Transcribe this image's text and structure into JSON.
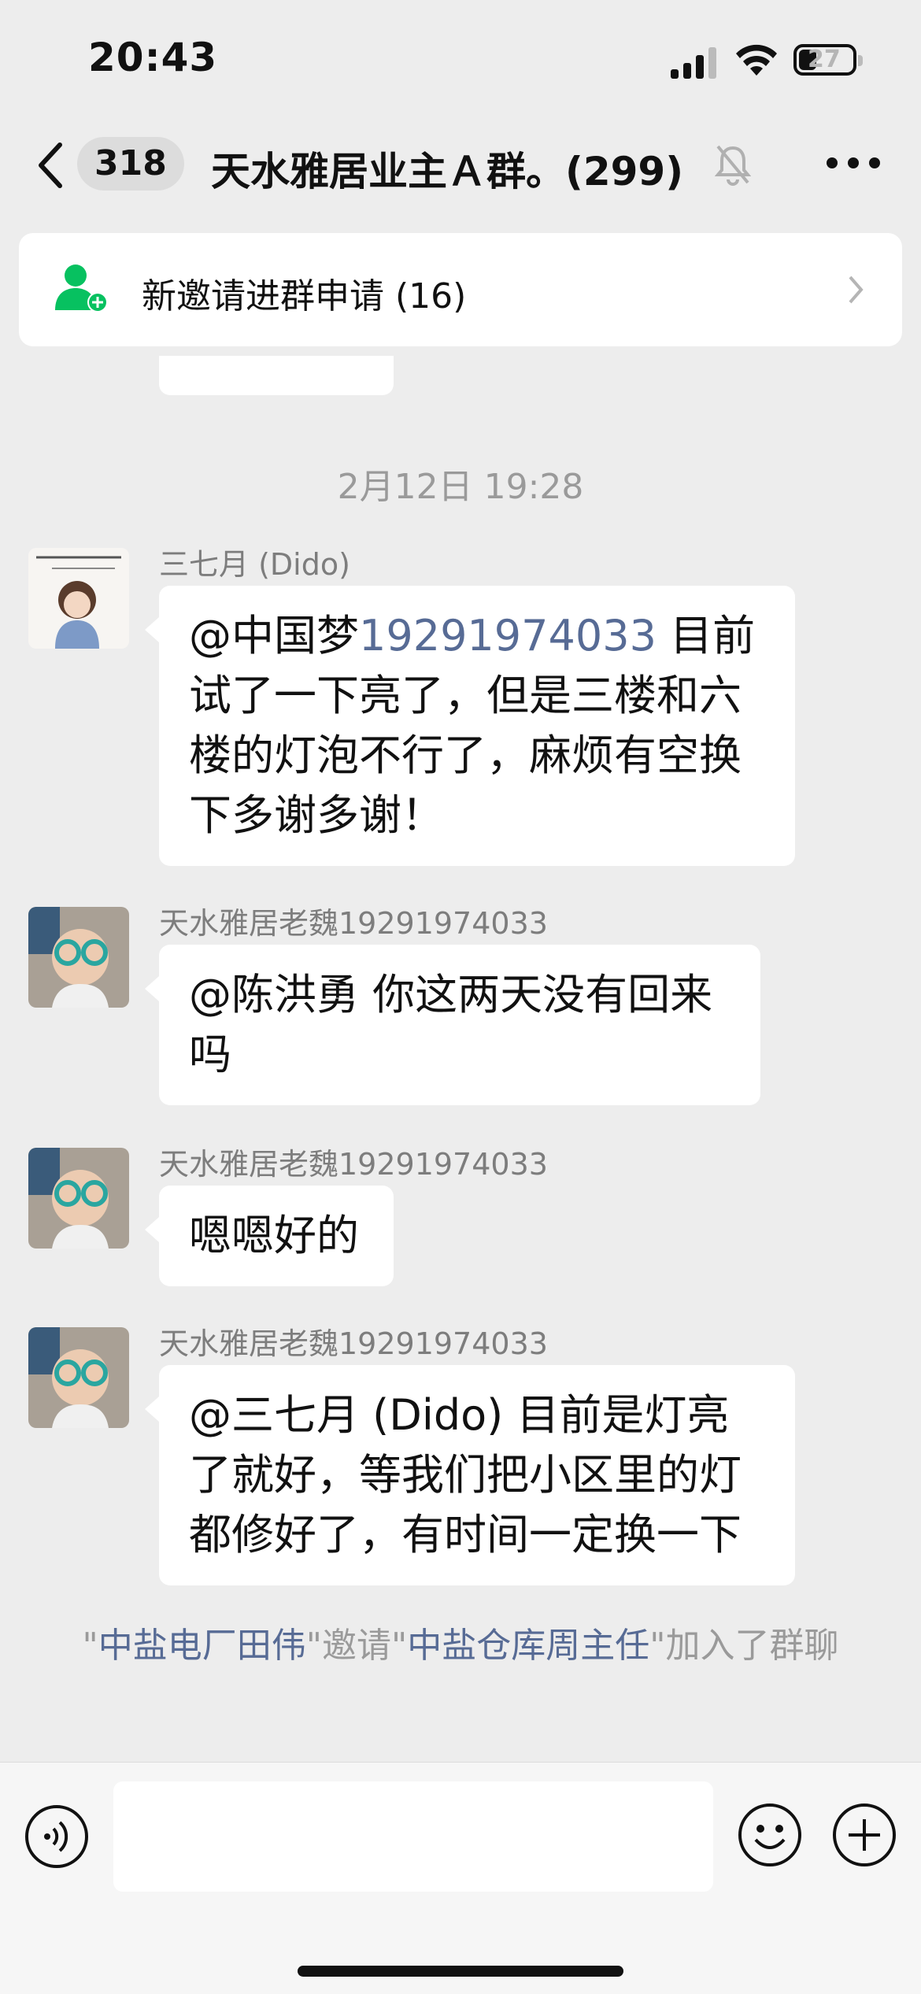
{
  "status_bar": {
    "time": "20:43",
    "battery": "27",
    "icons": [
      "signal-icon",
      "wifi-icon",
      "battery-icon"
    ]
  },
  "nav": {
    "unread_count": "318",
    "title": "天水雅居业主Ａ群。(299)",
    "icons": [
      "back-chevron-icon",
      "mute-bell-icon",
      "more-dots-icon"
    ]
  },
  "invite_banner": {
    "text": "新邀请进群申请 (16)",
    "icon": "add-member-icon"
  },
  "chat": {
    "timestamp": "2月12日 19:28",
    "messages": [
      {
        "sender": "三七月 (Dido)",
        "mention": "@中国梦",
        "link": "19291974033",
        "text": " 目前试了一下亮了，但是三楼和六楼的灯泡不行了，麻烦有空换下多谢多谢！"
      },
      {
        "sender": "天水雅居老魏19291974033",
        "text": "@陈洪勇 你这两天没有回来吗"
      },
      {
        "sender": "天水雅居老魏19291974033",
        "text": "嗯嗯好的"
      },
      {
        "sender": "天水雅居老魏19291974033",
        "text": "@三七月 (Dido) 目前是灯亮了就好，等我们把小区里的灯都修好了，有时间一定换一下"
      }
    ],
    "system_notice": {
      "q1": "\"",
      "inviter": "中盐电厂田伟",
      "mid": "\"邀请\"",
      "invitee": "中盐仓库周主任",
      "end": "\"加入了群聊"
    }
  },
  "input_bar": {
    "icons": [
      "voice-icon",
      "emoji-icon",
      "plus-icon"
    ]
  },
  "colors": {
    "background": "#ededed",
    "link": "#576b95",
    "bubble": "#ffffff",
    "green": "#07c160"
  }
}
